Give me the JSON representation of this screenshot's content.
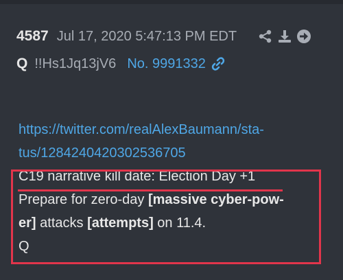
{
  "post": {
    "number": "4587",
    "date": "Jul 17, 2020 5:47:13 PM EDT",
    "author": "Q",
    "tripcode": "!!Hs1Jq13jV6",
    "post_no_label": "No. 9991332",
    "url_line1": "https://twitter.com/realAlexBaumann/sta-",
    "url_line2": "tus/1284240420302536705",
    "line1": "C19 narrative kill date: Election Day +1",
    "line2_a": "Prepare for zero-day ",
    "line2_b": "[massive cyber-pow-",
    "line3_a": "er]",
    "line3_b": " attacks ",
    "line3_c": "[attempts]",
    "line3_d": " on 11.4.",
    "signature": "Q"
  },
  "actions": {
    "icons": [
      "share-icon",
      "download-icon",
      "arrow-right-circle-icon"
    ]
  },
  "colors": {
    "background": "#2f333a",
    "link": "#4fa7e6",
    "highlight": "#e2354b",
    "muted": "#a8adb5",
    "text": "#e8e8e8"
  }
}
